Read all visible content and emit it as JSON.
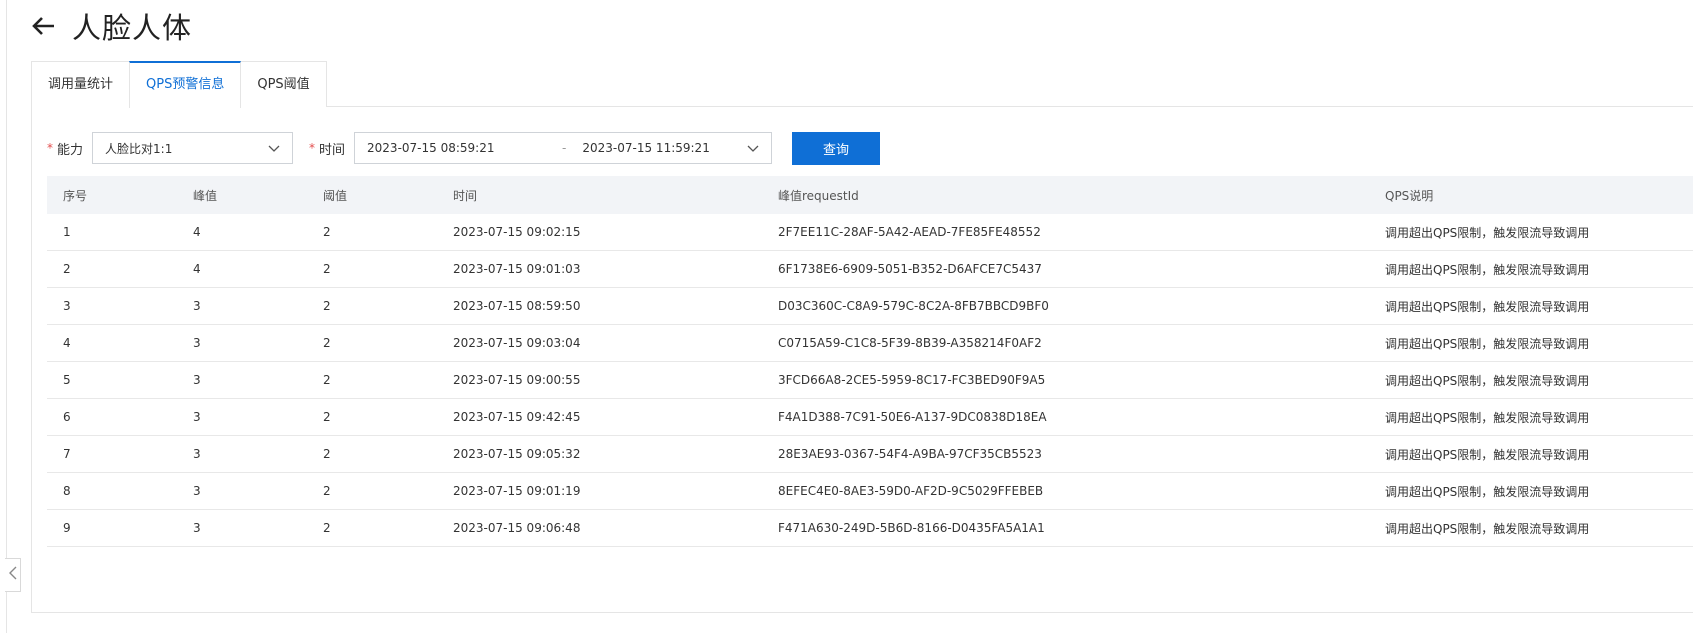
{
  "header": {
    "title": "人脸人体",
    "back_icon": "arrow-left-icon"
  },
  "tabs": [
    {
      "label": "调用量统计",
      "active": false
    },
    {
      "label": "QPS预警信息",
      "active": true
    },
    {
      "label": "QPS阈值",
      "active": false
    }
  ],
  "filters": {
    "capability_label": "能力",
    "capability_value": "人脸比对1:1",
    "time_label": "时间",
    "time_start": "2023-07-15 08:59:21",
    "time_sep": "-",
    "time_end": "2023-07-15 11:59:21",
    "required_mark": "*",
    "query_label": "查询"
  },
  "table": {
    "columns": [
      "序号",
      "峰值",
      "阈值",
      "时间",
      "峰值requestId",
      "QPS说明"
    ],
    "rows": [
      [
        "1",
        "4",
        "2",
        "2023-07-15 09:02:15",
        "2F7EE11C-28AF-5A42-AEAD-7FE85FE48552",
        "调用超出QPS限制，触发限流导致调用"
      ],
      [
        "2",
        "4",
        "2",
        "2023-07-15 09:01:03",
        "6F1738E6-6909-5051-B352-D6AFCE7C5437",
        "调用超出QPS限制，触发限流导致调用"
      ],
      [
        "3",
        "3",
        "2",
        "2023-07-15 08:59:50",
        "D03C360C-C8A9-579C-8C2A-8FB7BBCD9BF0",
        "调用超出QPS限制，触发限流导致调用"
      ],
      [
        "4",
        "3",
        "2",
        "2023-07-15 09:03:04",
        "C0715A59-C1C8-5F39-8B39-A358214F0AF2",
        "调用超出QPS限制，触发限流导致调用"
      ],
      [
        "5",
        "3",
        "2",
        "2023-07-15 09:00:55",
        "3FCD66A8-2CE5-5959-8C17-FC3BED90F9A5",
        "调用超出QPS限制，触发限流导致调用"
      ],
      [
        "6",
        "3",
        "2",
        "2023-07-15 09:42:45",
        "F4A1D388-7C91-50E6-A137-9DC0838D18EA",
        "调用超出QPS限制，触发限流导致调用"
      ],
      [
        "7",
        "3",
        "2",
        "2023-07-15 09:05:32",
        "28E3AE93-0367-54F4-A9BA-97CF35CB5523",
        "调用超出QPS限制，触发限流导致调用"
      ],
      [
        "8",
        "3",
        "2",
        "2023-07-15 09:01:19",
        "8EFEC4E0-8AE3-59D0-AF2D-9C5029FFEBEB",
        "调用超出QPS限制，触发限流导致调用"
      ],
      [
        "9",
        "3",
        "2",
        "2023-07-15 09:06:48",
        "F471A630-249D-5B6D-8166-D0435FA5A1A1",
        "调用超出QPS限制，触发限流导致调用"
      ]
    ]
  },
  "colors": {
    "accent": "#0f6fd6",
    "required": "#e34d4d",
    "header_bg": "#f2f4f7"
  },
  "icons": {
    "capability_dropdown": "chevron-down-icon",
    "time_dropdown": "chevron-down-icon",
    "sidebar_toggle": "chevron-left-icon"
  }
}
